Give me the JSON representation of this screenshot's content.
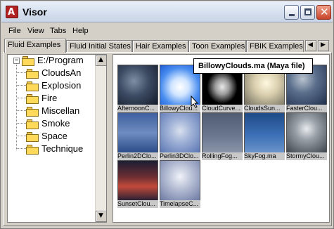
{
  "window": {
    "title": "Visor",
    "minimize_glyph": "",
    "close_glyph": "✕"
  },
  "app_icon": {
    "name": "maya-icon",
    "glyph": "A"
  },
  "menu": [
    "File",
    "View",
    "Tabs",
    "Help"
  ],
  "tabs": [
    "Fluid Examples",
    "Fluid Initial States",
    "Hair Examples",
    "Toon Examples",
    "FBIK Examples"
  ],
  "tab_scroll": {
    "left": "◀",
    "right": "▶"
  },
  "tree": {
    "root": {
      "label": "E:/Program",
      "expander": "−"
    },
    "children": [
      "CloudsAn",
      "Explosion",
      "Fire",
      "Miscellan",
      "Smoke",
      "Space",
      "Technique"
    ],
    "scroll_up": "▲",
    "scroll_down": "▼"
  },
  "thumbnails": [
    {
      "caption": "AfternoonC...",
      "style": "stormy-dark"
    },
    {
      "caption": "BillowyClou...",
      "style": "bright-blue"
    },
    {
      "caption": "CloudCurve...",
      "style": "black-puff"
    },
    {
      "caption": "CloudsSun...",
      "style": "sunny-beige"
    },
    {
      "caption": "FasterClou...",
      "style": "deep-blue"
    },
    {
      "caption": "Perlin2DClo...",
      "style": "perlin2d"
    },
    {
      "caption": "Perlin3DClo...",
      "style": "perlin3d"
    },
    {
      "caption": "RollingFog...",
      "style": "gray-fog"
    },
    {
      "caption": "SkyFog.ma",
      "style": "sky-blue"
    },
    {
      "caption": "StormyClou...",
      "style": "stormy-gray"
    },
    {
      "caption": "SunsetClou...",
      "style": "sunset"
    },
    {
      "caption": "TimelapseC...",
      "style": "timelapse"
    }
  ],
  "tooltip": "BillowyClouds.ma (Maya file)",
  "colors": {
    "title_gradient_top": "#e9f0fb",
    "window_bg": "#d4d0c8",
    "close_button": "#c7432a",
    "folder": "#ffd95a"
  }
}
